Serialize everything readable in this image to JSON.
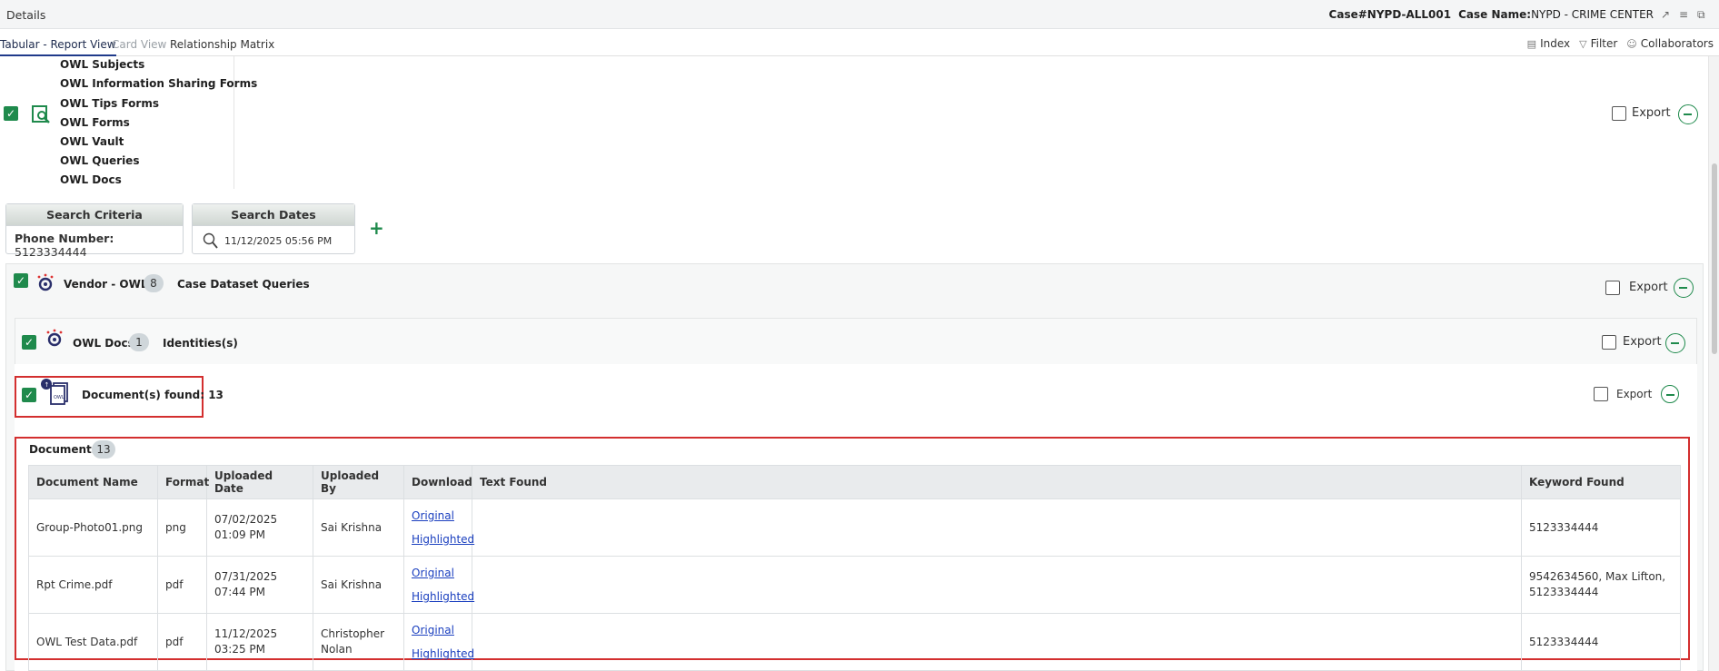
{
  "header": {
    "title": "Details",
    "case_label": "Case#NYPD-ALL001",
    "case_name_label": "Case Name:",
    "case_name": "NYPD - CRIME CENTER"
  },
  "tabs": [
    {
      "label": "Tabular - Report View",
      "state": "active"
    },
    {
      "label": "Card View",
      "state": "inactive"
    },
    {
      "label": "Relationship Matrix",
      "state": "normal"
    }
  ],
  "toolbar": {
    "index": "Index",
    "filter": "Filter",
    "collaborators": "Collaborators"
  },
  "sources": [
    "OWL Subjects",
    "OWL Information Sharing Forms",
    "OWL Tips Forms",
    "OWL Forms",
    "OWL Vault",
    "OWL Queries",
    "OWL Docs"
  ],
  "export_label": "Export",
  "search_criteria": {
    "title": "Search Criteria",
    "field_label": "Phone Number:",
    "field_value": "5123334444"
  },
  "search_dates": {
    "title": "Search Dates",
    "value": "11/12/2025 05:56 PM"
  },
  "vendor": {
    "name": "Vendor - OWL",
    "count": "8",
    "desc": "Case Dataset Queries"
  },
  "owl_docs": {
    "name": "OWL Docs",
    "count": "1",
    "desc": "Identities(s)"
  },
  "found": {
    "label": "Document(s) found: 13"
  },
  "documents": {
    "title": "Documents",
    "count": "13",
    "columns": [
      "Document Name",
      "Format",
      "Uploaded Date",
      "Uploaded By",
      "Download",
      "Text Found",
      "Keyword Found"
    ],
    "rows": [
      {
        "name": "Group-Photo01.png",
        "format": "png",
        "date": "07/02/2025 01:09 PM",
        "by": "Sai Krishna",
        "link1": "Original",
        "link2": "Highlighted",
        "text": "",
        "keyword": "5123334444"
      },
      {
        "name": "Rpt Crime.pdf",
        "format": "pdf",
        "date": "07/31/2025 07:44 PM",
        "by": "Sai Krishna",
        "link1": "Original",
        "link2": "Highlighted",
        "text": "",
        "keyword": "9542634560, Max Lifton, 5123334444"
      },
      {
        "name": "OWL Test Data.pdf",
        "format": "pdf",
        "date": "11/12/2025 03:25 PM",
        "by": "Christopher Nolan",
        "link1": "Original",
        "link2": "Highlighted",
        "text": "",
        "keyword": "5123334444"
      }
    ]
  }
}
